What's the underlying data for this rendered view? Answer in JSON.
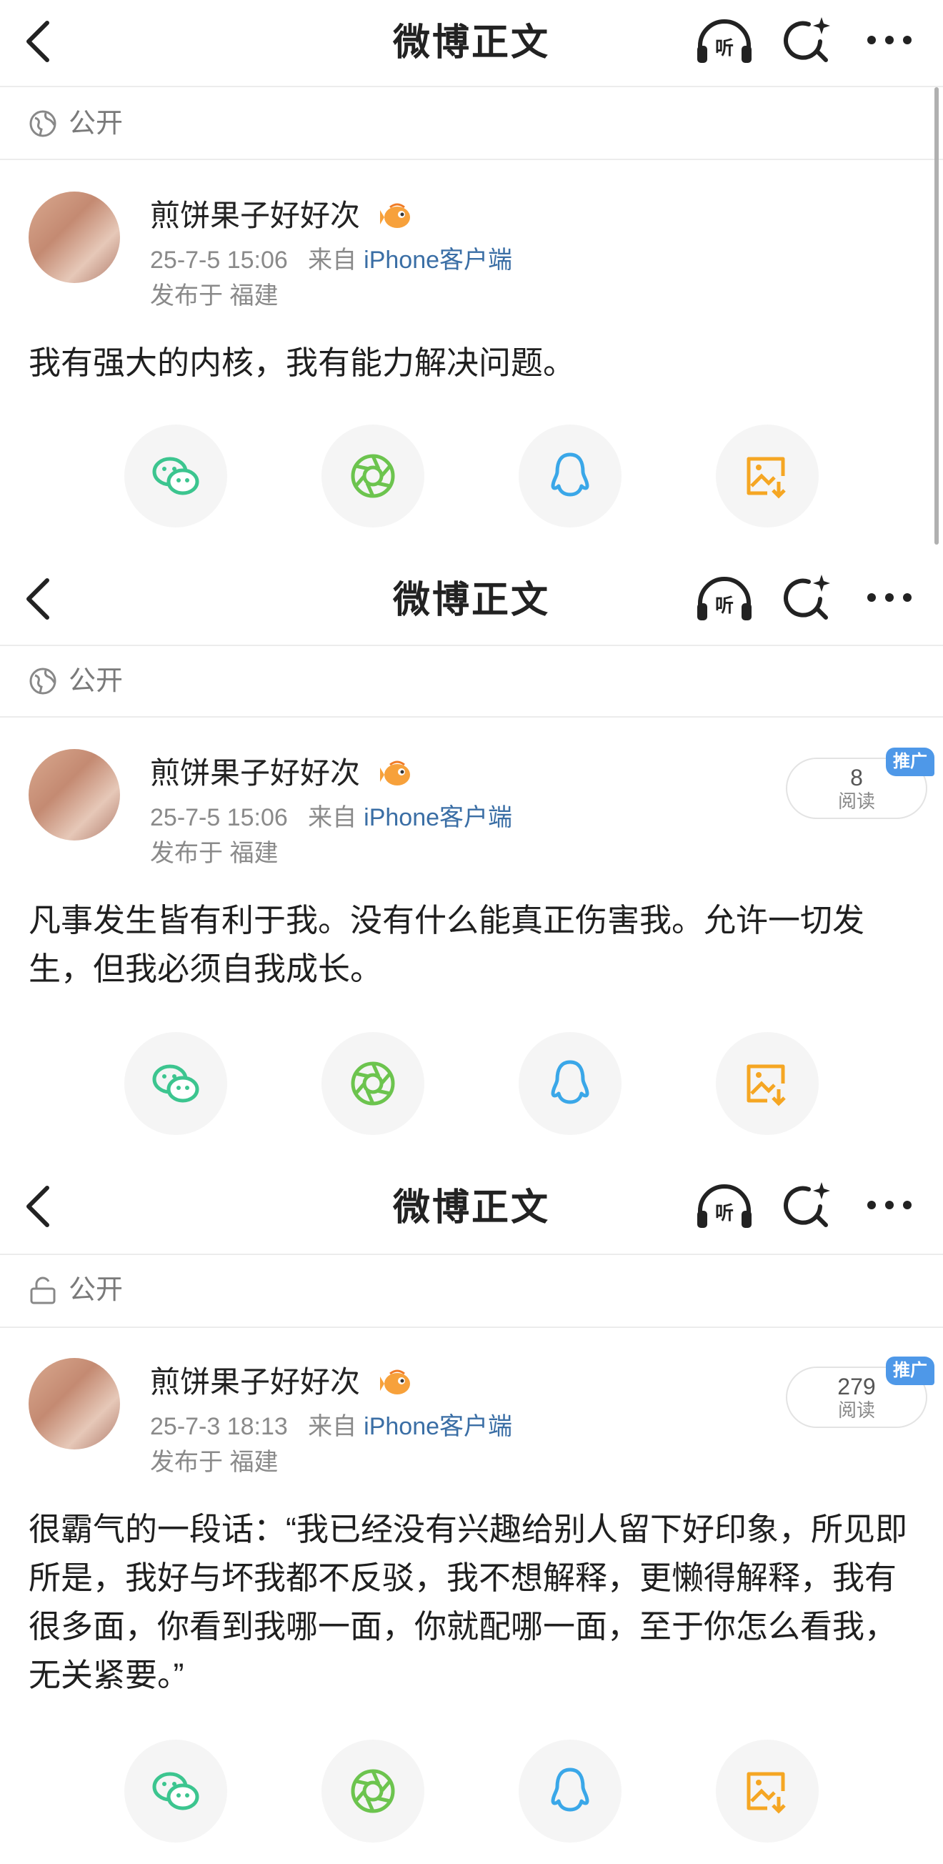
{
  "nav": {
    "title": "微博正文",
    "listen_label": "听"
  },
  "posts": [
    {
      "visibility": "公开",
      "visibility_icon": "globe-icon",
      "author": "煎饼果子好好次",
      "time": "25-7-5 15:06",
      "from": "来自",
      "source": "iPhone客户端",
      "location": "发布于 福建",
      "reads": null,
      "text": "我有强大的内核，我有能力解决问题。"
    },
    {
      "visibility": "公开",
      "visibility_icon": "globe-icon",
      "author": "煎饼果子好好次",
      "time": "25-7-5 15:06",
      "from": "来自",
      "source": "iPhone客户端",
      "location": "发布于 福建",
      "reads": {
        "count": "8",
        "label": "阅读",
        "promo": "推广"
      },
      "text": "凡事发生皆有利于我。没有什么能真正伤害我。允许一切发生，但我必须自我成长。"
    },
    {
      "visibility": "公开",
      "visibility_icon": "unlock-icon",
      "author": "煎饼果子好好次",
      "time": "25-7-3 18:13",
      "from": "来自",
      "source": "iPhone客户端",
      "location": "发布于 福建",
      "reads": {
        "count": "279",
        "label": "阅读",
        "promo": "推广"
      },
      "text": "很霸气的一段话：“我已经没有兴趣给别人留下好印象，所见即所是，我好与坏我都不反驳，我不想解释，更懒得解释，我有很多面，你看到我哪一面，你就配哪一面，至于你怎么看我，无关紧要。”"
    }
  ],
  "share": [
    "wechat-icon",
    "moments-icon",
    "qq-icon",
    "save-image-icon"
  ],
  "colors": {
    "wechat": "#3cc58f",
    "moments": "#6cc44e",
    "qq": "#3aa7e8",
    "save": "#f5a623",
    "link": "#3a6ea5",
    "promo": "#4e98e8"
  }
}
